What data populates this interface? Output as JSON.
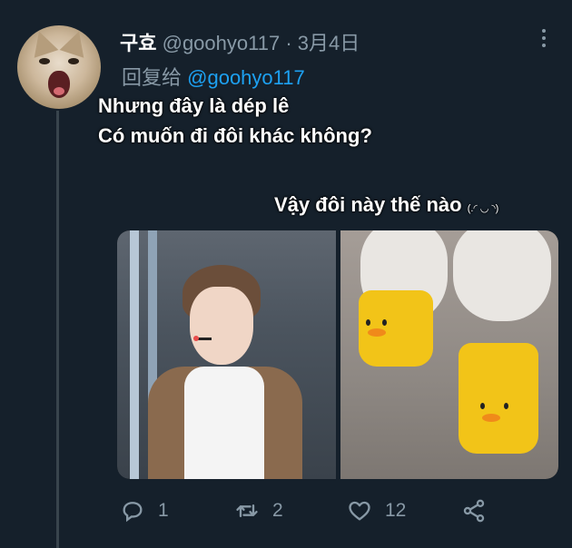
{
  "tweet": {
    "display_name": "구효",
    "handle": "@goohyo117",
    "separator": "·",
    "date": "3月4日",
    "reply_prefix": "回复给",
    "reply_target": "@goohyo117"
  },
  "overlay": {
    "line1": "Nhưng đây là dép lê",
    "line2": "Có muốn đi đôi khác không?",
    "line3": "Vậy đôi này thế nào",
    "kaomoji": "(.◜ ◡ ◝)"
  },
  "actions": {
    "replies": "1",
    "retweets": "2",
    "likes": "12"
  },
  "icons": {
    "reply": "speech-bubble-icon",
    "retweet": "retweet-icon",
    "like": "heart-icon",
    "share": "share-icon",
    "more": "more-vertical-icon"
  },
  "colors": {
    "background": "#15202b",
    "text": "#ffffff",
    "muted": "#8899a6",
    "link": "#1da1f2",
    "line": "#38444d"
  }
}
